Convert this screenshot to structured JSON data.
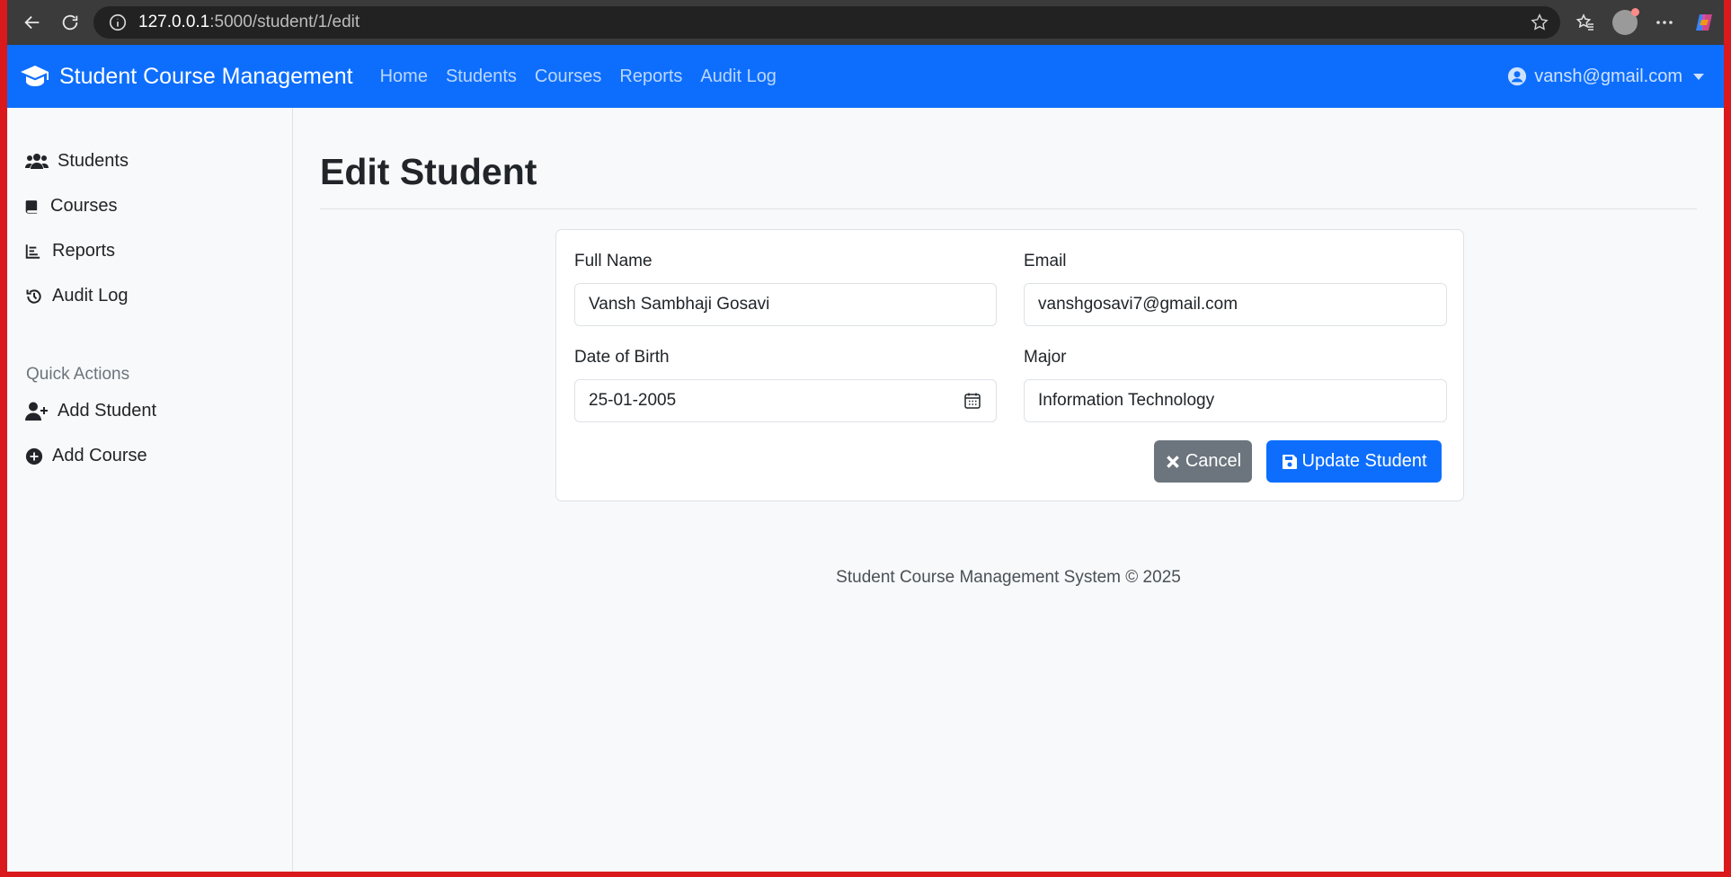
{
  "browser": {
    "url_host": "127.0.0.1",
    "url_path": ":5000/student/1/edit"
  },
  "navbar": {
    "brand": "Student Course Management",
    "links": [
      "Home",
      "Students",
      "Courses",
      "Reports",
      "Audit Log"
    ],
    "user": "vansh@gmail.com"
  },
  "sidebar": {
    "items": [
      {
        "label": "Students",
        "icon": "users-icon"
      },
      {
        "label": "Courses",
        "icon": "book-icon"
      },
      {
        "label": "Reports",
        "icon": "chart-icon"
      },
      {
        "label": "Audit Log",
        "icon": "history-icon"
      }
    ],
    "quick_actions_heading": "Quick Actions",
    "quick_actions": [
      {
        "label": "Add Student",
        "icon": "user-plus-icon"
      },
      {
        "label": "Add Course",
        "icon": "plus-circle-icon"
      }
    ]
  },
  "page": {
    "title": "Edit Student"
  },
  "form": {
    "full_name_label": "Full Name",
    "full_name_value": "Vansh Sambhaji Gosavi",
    "email_label": "Email",
    "email_value": "vanshgosavi7@gmail.com",
    "dob_label": "Date of Birth",
    "dob_value": "25-01-2005",
    "major_label": "Major",
    "major_value": "Information Technology",
    "cancel_label": "Cancel",
    "update_label": "Update Student"
  },
  "footer": {
    "text": "Student Course Management System © 2025"
  },
  "colors": {
    "primary": "#0d6efd",
    "secondary": "#6c757d",
    "background": "#f8f9fa"
  }
}
